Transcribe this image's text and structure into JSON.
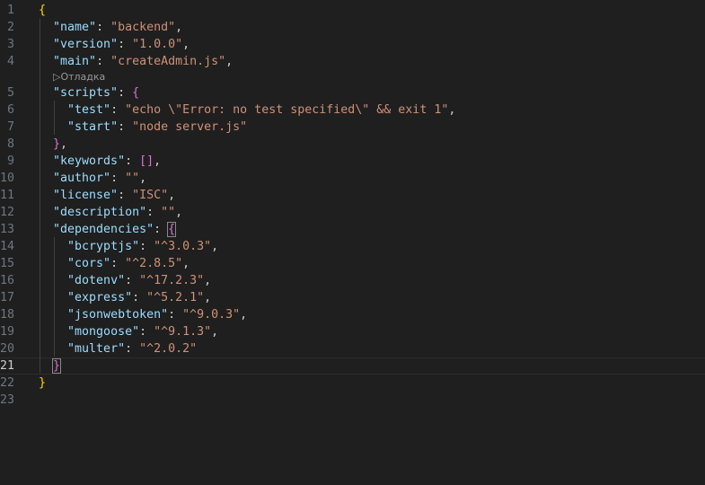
{
  "editor": {
    "codelens": "▷Отладка",
    "lines": [
      {
        "no": "1",
        "parts": [
          [
            "b1",
            "{"
          ]
        ]
      },
      {
        "no": "2",
        "parts": [
          [
            "p",
            "  "
          ],
          [
            "k",
            "\"name\""
          ],
          [
            "p",
            ": "
          ],
          [
            "s",
            "\"backend\""
          ],
          [
            "p",
            ","
          ]
        ]
      },
      {
        "no": "3",
        "parts": [
          [
            "p",
            "  "
          ],
          [
            "k",
            "\"version\""
          ],
          [
            "p",
            ": "
          ],
          [
            "s",
            "\"1.0.0\""
          ],
          [
            "p",
            ","
          ]
        ]
      },
      {
        "no": "4",
        "parts": [
          [
            "p",
            "  "
          ],
          [
            "k",
            "\"main\""
          ],
          [
            "p",
            ": "
          ],
          [
            "s",
            "\"createAdmin.js\""
          ],
          [
            "p",
            ","
          ]
        ]
      },
      {
        "no": "5",
        "parts": [
          [
            "p",
            "  "
          ],
          [
            "k",
            "\"scripts\""
          ],
          [
            "p",
            ": "
          ],
          [
            "b2",
            "{"
          ]
        ]
      },
      {
        "no": "6",
        "parts": [
          [
            "p",
            "    "
          ],
          [
            "k",
            "\"test\""
          ],
          [
            "p",
            ": "
          ],
          [
            "s",
            "\"echo \\\"Error: no test specified\\\" && exit 1\""
          ],
          [
            "p",
            ","
          ]
        ]
      },
      {
        "no": "7",
        "parts": [
          [
            "p",
            "    "
          ],
          [
            "k",
            "\"start\""
          ],
          [
            "p",
            ": "
          ],
          [
            "s",
            "\"node server.js\""
          ]
        ]
      },
      {
        "no": "8",
        "parts": [
          [
            "p",
            "  "
          ],
          [
            "b2",
            "}"
          ],
          [
            "p",
            ","
          ]
        ]
      },
      {
        "no": "9",
        "parts": [
          [
            "p",
            "  "
          ],
          [
            "k",
            "\"keywords\""
          ],
          [
            "p",
            ": "
          ],
          [
            "b2",
            "[]"
          ],
          [
            "p",
            ","
          ]
        ]
      },
      {
        "no": "10",
        "parts": [
          [
            "p",
            "  "
          ],
          [
            "k",
            "\"author\""
          ],
          [
            "p",
            ": "
          ],
          [
            "s",
            "\"\""
          ],
          [
            "p",
            ","
          ]
        ]
      },
      {
        "no": "11",
        "parts": [
          [
            "p",
            "  "
          ],
          [
            "k",
            "\"license\""
          ],
          [
            "p",
            ": "
          ],
          [
            "s",
            "\"ISC\""
          ],
          [
            "p",
            ","
          ]
        ]
      },
      {
        "no": "12",
        "parts": [
          [
            "p",
            "  "
          ],
          [
            "k",
            "\"description\""
          ],
          [
            "p",
            ": "
          ],
          [
            "s",
            "\"\""
          ],
          [
            "p",
            ","
          ]
        ]
      },
      {
        "no": "13",
        "parts": [
          [
            "p",
            "  "
          ],
          [
            "k",
            "\"dependencies\""
          ],
          [
            "p",
            ": "
          ],
          [
            "b2 hl",
            "{"
          ]
        ]
      },
      {
        "no": "14",
        "parts": [
          [
            "p",
            "    "
          ],
          [
            "k",
            "\"bcryptjs\""
          ],
          [
            "p",
            ": "
          ],
          [
            "s",
            "\"^3.0.3\""
          ],
          [
            "p",
            ","
          ]
        ]
      },
      {
        "no": "15",
        "parts": [
          [
            "p",
            "    "
          ],
          [
            "k",
            "\"cors\""
          ],
          [
            "p",
            ": "
          ],
          [
            "s",
            "\"^2.8.5\""
          ],
          [
            "p",
            ","
          ]
        ]
      },
      {
        "no": "16",
        "parts": [
          [
            "p",
            "    "
          ],
          [
            "k",
            "\"dotenv\""
          ],
          [
            "p",
            ": "
          ],
          [
            "s",
            "\"^17.2.3\""
          ],
          [
            "p",
            ","
          ]
        ]
      },
      {
        "no": "17",
        "parts": [
          [
            "p",
            "    "
          ],
          [
            "k",
            "\"express\""
          ],
          [
            "p",
            ": "
          ],
          [
            "s",
            "\"^5.2.1\""
          ],
          [
            "p",
            ","
          ]
        ]
      },
      {
        "no": "18",
        "parts": [
          [
            "p",
            "    "
          ],
          [
            "k",
            "\"jsonwebtoken\""
          ],
          [
            "p",
            ": "
          ],
          [
            "s",
            "\"^9.0.3\""
          ],
          [
            "p",
            ","
          ]
        ]
      },
      {
        "no": "19",
        "parts": [
          [
            "p",
            "    "
          ],
          [
            "k",
            "\"mongoose\""
          ],
          [
            "p",
            ": "
          ],
          [
            "s",
            "\"^9.1.3\""
          ],
          [
            "p",
            ","
          ]
        ]
      },
      {
        "no": "20",
        "parts": [
          [
            "p",
            "    "
          ],
          [
            "k",
            "\"multer\""
          ],
          [
            "p",
            ": "
          ],
          [
            "s",
            "\"^2.0.2\""
          ]
        ]
      },
      {
        "no": "21",
        "parts": [
          [
            "p",
            "  "
          ],
          [
            "b2 hl",
            "}"
          ]
        ],
        "current": true
      },
      {
        "no": "22",
        "parts": [
          [
            "b1",
            "}"
          ]
        ]
      },
      {
        "no": "23",
        "parts": []
      }
    ]
  }
}
